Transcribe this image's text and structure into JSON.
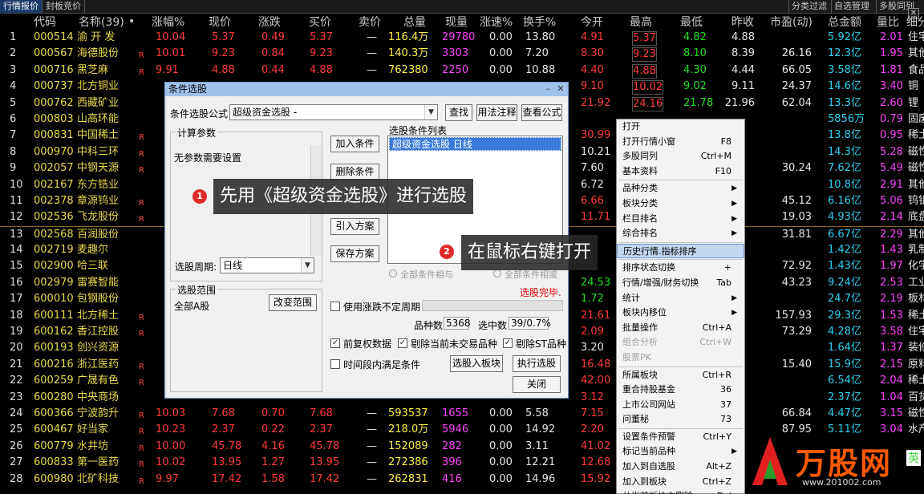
{
  "tabs": [
    {
      "label": "行情报价",
      "active": true
    },
    {
      "label": "封板竞价",
      "active": false
    }
  ],
  "top_right_tabs": [
    "分类过滤",
    "自选管理",
    "多股同列"
  ],
  "columns": [
    "代码",
    "名称(39)",
    "•",
    "涨幅%",
    "现价",
    "涨跌",
    "买价",
    "卖价",
    "总量",
    "现量",
    "涨速%",
    "换手%",
    "今开",
    "最高",
    "最低",
    "昨收",
    "市盈(动)",
    "总金额",
    "量比",
    "细分"
  ],
  "rows": [
    {
      "no": "1",
      "code": "000514",
      "name": "渝 开 发",
      "r": "",
      "pct": "10.04",
      "price": "5.37",
      "chg": "0.49",
      "bid": "5.37",
      "ask": "—",
      "vol": "116.4万",
      "cur": "29780",
      "spd": "0.00",
      "turn": "13.80",
      "open": "4.91",
      "high": "5.37",
      "low": "4.82",
      "prev": "4.88",
      "pe": "",
      "amt": "5.92亿",
      "qr": "2.01",
      "ind": "住宅"
    },
    {
      "no": "2",
      "code": "000567",
      "name": "海德股份",
      "r": "R",
      "pct": "10.01",
      "price": "9.23",
      "chg": "0.84",
      "bid": "9.23",
      "ask": "—",
      "vol": "140.3万",
      "cur": "3303",
      "spd": "0.00",
      "turn": "7.20",
      "open": "8.30",
      "high": "9.23",
      "low": "8.10",
      "prev": "8.39",
      "pe": "26.16",
      "amt": "12.3亿",
      "qr": "1.95",
      "ind": "其他"
    },
    {
      "no": "3",
      "code": "000716",
      "name": "黑芝麻",
      "r": "R",
      "pct": "9.91",
      "price": "4.88",
      "chg": "0.44",
      "bid": "4.88",
      "ask": "—",
      "vol": "762380",
      "cur": "2250",
      "spd": "0.00",
      "turn": "10.88",
      "open": "4.40",
      "high": "4.88",
      "low": "4.30",
      "prev": "4.44",
      "pe": "66.05",
      "amt": "3.58亿",
      "qr": "1.81",
      "ind": "食品"
    },
    {
      "no": "4",
      "code": "000737",
      "name": "北方铜业",
      "r": "",
      "pct": "",
      "price": "",
      "chg": "",
      "bid": "",
      "ask": "",
      "vol": "",
      "cur": "",
      "spd": "",
      "turn": "",
      "open": "9.10",
      "high": "10.02",
      "low": "9.02",
      "prev": "9.11",
      "pe": "24.37",
      "amt": "14.6亿",
      "qr": "3.40",
      "ind": "铜"
    },
    {
      "no": "5",
      "code": "000762",
      "name": "西藏矿业",
      "r": "",
      "pct": "",
      "price": "",
      "chg": "",
      "bid": "",
      "ask": "",
      "vol": "",
      "cur": "",
      "spd": "",
      "turn": "",
      "open": "21.92",
      "high": "24.16",
      "low": "21.78",
      "prev": "21.96",
      "pe": "62.04",
      "amt": "13.3亿",
      "qr": "2.60",
      "ind": "锂"
    },
    {
      "no": "6",
      "code": "000803",
      "name": "山高环能",
      "r": "",
      "pct": "",
      "price": "",
      "chg": "",
      "bid": "",
      "ask": "",
      "vol": "",
      "cur": "",
      "spd": "",
      "turn": "",
      "open": "",
      "high": "",
      "low": "",
      "prev": "",
      "pe": "",
      "amt": "5856万",
      "qr": "0.79",
      "ind": "固废"
    },
    {
      "no": "7",
      "code": "000831",
      "name": "中国稀土",
      "r": "R",
      "pct": "",
      "price": "",
      "chg": "",
      "bid": "",
      "ask": "",
      "vol": "",
      "cur": "",
      "spd": "",
      "turn": "",
      "open": "30.99",
      "high": "",
      "low": "",
      "prev": "",
      "pe": "",
      "amt": "13.8亿",
      "qr": "0.95",
      "ind": "稀土"
    },
    {
      "no": "8",
      "code": "000970",
      "name": "中科三环",
      "r": "R",
      "pct": "",
      "price": "",
      "chg": "",
      "bid": "",
      "ask": "",
      "vol": "",
      "cur": "",
      "spd": "",
      "turn": "",
      "open": "10.21",
      "high": "",
      "low": "",
      "prev": "",
      "pe": "",
      "amt": "14.3亿",
      "qr": "5.28",
      "ind": "磁性"
    },
    {
      "no": "9",
      "code": "002057",
      "name": "中钢天源",
      "r": "R",
      "pct": "",
      "price": "",
      "chg": "",
      "bid": "",
      "ask": "",
      "vol": "",
      "cur": "",
      "spd": "",
      "turn": "",
      "open": "7.60",
      "high": "",
      "low": "",
      "prev": "",
      "pe": "30.24",
      "amt": "7.62亿",
      "qr": "5.49",
      "ind": "磁性"
    },
    {
      "no": "10",
      "code": "002167",
      "name": "东方锆业",
      "r": "",
      "pct": "",
      "price": "",
      "chg": "",
      "bid": "",
      "ask": "",
      "vol": "",
      "cur": "",
      "spd": "",
      "turn": "",
      "open": "6.72",
      "high": "",
      "low": "",
      "prev": "",
      "pe": "",
      "amt": "10.8亿",
      "qr": "2.91",
      "ind": "其他"
    },
    {
      "no": "11",
      "code": "002378",
      "name": "章源钨业",
      "r": "R",
      "pct": "",
      "price": "",
      "chg": "",
      "bid": "",
      "ask": "",
      "vol": "",
      "cur": "",
      "spd": "",
      "turn": "",
      "open": "6.66",
      "high": "",
      "low": "",
      "prev": "",
      "pe": "45.12",
      "amt": "6.16亿",
      "qr": "5.06",
      "ind": "钨钼"
    },
    {
      "no": "12",
      "code": "002536",
      "name": "飞龙股份",
      "r": "R",
      "pct": "",
      "price": "",
      "chg": "",
      "bid": "",
      "ask": "",
      "vol": "",
      "cur": "",
      "spd": "",
      "turn": "",
      "open": "11.71",
      "high": "",
      "low": "",
      "prev": "",
      "pe": "19.03",
      "amt": "4.93亿",
      "qr": "2.14",
      "ind": "底盘"
    },
    {
      "no": "13",
      "code": "002568",
      "name": "百润股份",
      "r": "",
      "pct": "",
      "price": "",
      "chg": "",
      "bid": "",
      "ask": "",
      "vol": "",
      "cur": "",
      "spd": "",
      "turn": "",
      "open": "",
      "high": "",
      "low": "",
      "prev": "",
      "pe": "31.81",
      "amt": "6.67亿",
      "qr": "2.29",
      "ind": "其他"
    },
    {
      "no": "14",
      "code": "002719",
      "name": "麦趣尔",
      "r": "",
      "pct": "",
      "price": "",
      "chg": "",
      "bid": "",
      "ask": "",
      "vol": "",
      "cur": "",
      "spd": "",
      "turn": "",
      "open": "",
      "high": "",
      "low": "",
      "prev": "",
      "pe": "",
      "amt": "1.42亿",
      "qr": "1.43",
      "ind": "乳制"
    },
    {
      "no": "15",
      "code": "002900",
      "name": "哈三联",
      "r": "",
      "pct": "",
      "price": "",
      "chg": "",
      "bid": "",
      "ask": "",
      "vol": "",
      "cur": "",
      "spd": "",
      "turn": "",
      "open": "",
      "high": "",
      "low": "",
      "prev": "",
      "pe": "72.92",
      "amt": "1.43亿",
      "qr": "1.97",
      "ind": "化学"
    },
    {
      "no": "16",
      "code": "002979",
      "name": "雷赛智能",
      "r": "",
      "pct": "",
      "price": "",
      "chg": "",
      "bid": "",
      "ask": "",
      "vol": "",
      "cur": "",
      "spd": "",
      "turn": "",
      "open": "24.53",
      "high": "",
      "low": "",
      "prev": "",
      "pe": "43.23",
      "amt": "9.24亿",
      "qr": "2.53",
      "ind": "工业"
    },
    {
      "no": "17",
      "code": "600010",
      "name": "包钢股份",
      "r": "",
      "pct": "",
      "price": "",
      "chg": "",
      "bid": "",
      "ask": "",
      "vol": "",
      "cur": "",
      "spd": "",
      "turn": "",
      "open": "1.72",
      "high": "",
      "low": "",
      "prev": "",
      "pe": "",
      "amt": "24.7亿",
      "qr": "2.19",
      "ind": "板材"
    },
    {
      "no": "18",
      "code": "600111",
      "name": "北方稀土",
      "r": "R",
      "pct": "",
      "price": "",
      "chg": "",
      "bid": "",
      "ask": "",
      "vol": "",
      "cur": "",
      "spd": "",
      "turn": "",
      "open": "21.61",
      "high": "",
      "low": "",
      "prev": "",
      "pe": "157.93",
      "amt": "29.3亿",
      "qr": "1.53",
      "ind": "稀土"
    },
    {
      "no": "19",
      "code": "600162",
      "name": "香江控股",
      "r": "R",
      "pct": "",
      "price": "",
      "chg": "",
      "bid": "",
      "ask": "",
      "vol": "",
      "cur": "",
      "spd": "",
      "turn": "",
      "open": "2.09",
      "high": "",
      "low": "",
      "prev": "",
      "pe": "73.29",
      "amt": "4.28亿",
      "qr": "3.58",
      "ind": "住宅"
    },
    {
      "no": "20",
      "code": "600193",
      "name": "创兴资源",
      "r": "",
      "pct": "",
      "price": "",
      "chg": "",
      "bid": "",
      "ask": "",
      "vol": "",
      "cur": "",
      "spd": "",
      "turn": "",
      "open": "3.20",
      "high": "",
      "low": "",
      "prev": "",
      "pe": "",
      "amt": "1.64亿",
      "qr": "1.37",
      "ind": "装修"
    },
    {
      "no": "21",
      "code": "600216",
      "name": "浙江医药",
      "r": "R",
      "pct": "",
      "price": "",
      "chg": "",
      "bid": "",
      "ask": "",
      "vol": "",
      "cur": "",
      "spd": "",
      "turn": "",
      "open": "16.48",
      "high": "",
      "low": "",
      "prev": "",
      "pe": "15.40",
      "amt": "15.9亿",
      "qr": "2.15",
      "ind": "原料"
    },
    {
      "no": "22",
      "code": "600259",
      "name": "广晟有色",
      "r": "R",
      "pct": "",
      "price": "",
      "chg": "",
      "bid": "",
      "ask": "",
      "vol": "",
      "cur": "",
      "spd": "",
      "turn": "",
      "open": "42.00",
      "high": "",
      "low": "",
      "prev": "",
      "pe": "",
      "amt": "6.54亿",
      "qr": "2.04",
      "ind": "稀土"
    },
    {
      "no": "23",
      "code": "600280",
      "name": "中央商场",
      "r": "",
      "pct": "",
      "price": "",
      "chg": "",
      "bid": "",
      "ask": "",
      "vol": "",
      "cur": "",
      "spd": "",
      "turn": "",
      "open": "3.12",
      "high": "",
      "low": "",
      "prev": "",
      "pe": "",
      "amt": "2.37亿",
      "qr": "1.04",
      "ind": "百货"
    },
    {
      "no": "24",
      "code": "600366",
      "name": "宁波韵升",
      "r": "R",
      "pct": "10.03",
      "price": "7.68",
      "chg": "0.70",
      "bid": "7.68",
      "ask": "—",
      "vol": "593537",
      "cur": "1655",
      "spd": "0.00",
      "turn": "5.58",
      "open": "7.15",
      "high": "",
      "low": "",
      "prev": "",
      "pe": "66.84",
      "amt": "4.47亿",
      "qr": "3.15",
      "ind": "磁性"
    },
    {
      "no": "25",
      "code": "600467",
      "name": "好当家",
      "r": "R",
      "pct": "10.23",
      "price": "2.37",
      "chg": "0.22",
      "bid": "2.37",
      "ask": "—",
      "vol": "218.0万",
      "cur": "5946",
      "spd": "0.00",
      "turn": "14.92",
      "open": "2.20",
      "high": "",
      "low": "",
      "prev": "",
      "pe": "87.95",
      "amt": "5.11亿",
      "qr": "3.04",
      "ind": "水产"
    },
    {
      "no": "26",
      "code": "600779",
      "name": "水井坊",
      "r": "R",
      "pct": "10.00",
      "price": "45.78",
      "chg": "4.16",
      "bid": "45.78",
      "ask": "—",
      "vol": "152089",
      "cur": "282",
      "spd": "0.00",
      "turn": "3.11",
      "open": "41.02",
      "high": "",
      "low": "",
      "prev": "",
      "pe": "",
      "amt": "",
      "qr": "",
      "ind": ""
    },
    {
      "no": "27",
      "code": "600833",
      "name": "第一医药",
      "r": "R",
      "pct": "10.02",
      "price": "13.95",
      "chg": "1.27",
      "bid": "13.95",
      "ask": "—",
      "vol": "272386",
      "cur": "396",
      "spd": "0.00",
      "turn": "12.21",
      "open": "12.68",
      "high": "",
      "low": "",
      "prev": "",
      "pe": "",
      "amt": "",
      "qr": "",
      "ind": ""
    },
    {
      "no": "28",
      "code": "600980",
      "name": "北矿科技",
      "r": "R",
      "pct": "9.97",
      "price": "17.42",
      "chg": "1.58",
      "bid": "17.42",
      "ask": "—",
      "vol": "262831",
      "cur": "416",
      "spd": "0.00",
      "turn": "14.96",
      "open": "15.92",
      "high": "",
      "low": "",
      "prev": "",
      "pe": "",
      "amt": "",
      "qr": "",
      "ind": ""
    }
  ],
  "dialog": {
    "title": "条件选股",
    "formula_label": "条件选股公式",
    "formula_value": "超级资金选股 -",
    "btn_find": "查找",
    "btn_usage": "用法注释",
    "btn_view_formula": "查看公式",
    "calc_params_title": "计算参数",
    "no_params": "无参数需要设置",
    "btn_add": "加入条件",
    "btn_delete": "删除条件",
    "btn_import": "引入方案",
    "btn_save": "保存方案",
    "cond_list_title": "选股条件列表",
    "cond_item": "超级资金选股  日线",
    "period_label": "选股周期:",
    "period_value": "日线",
    "radio_and": "全部条件相与",
    "radio_or": "全部条件相或",
    "done": "选股完毕.",
    "range_title": "选股范围",
    "range_value": "全部A股",
    "btn_change_range": "改变范围",
    "chk_uncertain": "使用涨跌不定周期",
    "total_label": "品种数",
    "total_value": "5368",
    "selected_label": "选中数",
    "selected_value": "39/0.7%",
    "chk_fq": "前复权数据",
    "chk_exclude_untraded": "剔除当前未交易品种",
    "chk_exclude_st": "剔除ST品种",
    "chk_period_meet": "时间段内满足条件",
    "btn_to_block": "选股入板块",
    "btn_execute": "执行选股",
    "btn_close": "关闭"
  },
  "annotations": [
    {
      "num": "1",
      "text": "先用《超级资金选股》进行选股"
    },
    {
      "num": "2",
      "text": "在鼠标右键打开"
    }
  ],
  "menu": [
    {
      "label": "打开",
      "key": "",
      "sub": false,
      "hl": false,
      "dis": false,
      "sep_after": false
    },
    {
      "label": "打开行情小窗",
      "key": "F8",
      "sub": false,
      "hl": false,
      "dis": false,
      "sep_after": false
    },
    {
      "label": "多股同列",
      "key": "Ctrl+M",
      "sub": false,
      "hl": false,
      "dis": false,
      "sep_after": false
    },
    {
      "label": "基本资料",
      "key": "F10",
      "sub": false,
      "hl": false,
      "dis": false,
      "sep_after": true
    },
    {
      "label": "品种分类",
      "key": "",
      "sub": true,
      "hl": false,
      "dis": false,
      "sep_after": false
    },
    {
      "label": "板块分类",
      "key": "",
      "sub": true,
      "hl": false,
      "dis": false,
      "sep_after": false
    },
    {
      "label": "栏目排名",
      "key": "",
      "sub": true,
      "hl": false,
      "dis": false,
      "sep_after": false
    },
    {
      "label": "综合排名",
      "key": "",
      "sub": true,
      "hl": false,
      "dis": false,
      "sep_after": true
    },
    {
      "label": "历史行情.指标排序",
      "key": "",
      "sub": false,
      "hl": true,
      "dis": false,
      "sep_after": true
    },
    {
      "label": "排序状态切换",
      "key": "+",
      "sub": false,
      "hl": false,
      "dis": false,
      "sep_after": false
    },
    {
      "label": "行情/增强/财务切换",
      "key": "Tab",
      "sub": false,
      "hl": false,
      "dis": false,
      "sep_after": false
    },
    {
      "label": "统计",
      "key": "",
      "sub": true,
      "hl": false,
      "dis": false,
      "sep_after": false
    },
    {
      "label": "板块内移位",
      "key": "",
      "sub": true,
      "hl": false,
      "dis": false,
      "sep_after": false
    },
    {
      "label": "批量操作",
      "key": "Ctrl+A",
      "sub": false,
      "hl": false,
      "dis": false,
      "sep_after": false
    },
    {
      "label": "组合分析",
      "key": "Ctrl+W",
      "sub": false,
      "hl": false,
      "dis": true,
      "sep_after": false
    },
    {
      "label": "股票PK",
      "key": "",
      "sub": false,
      "hl": false,
      "dis": true,
      "sep_after": true
    },
    {
      "label": "所属板块",
      "key": "Ctrl+R",
      "sub": false,
      "hl": false,
      "dis": false,
      "sep_after": false
    },
    {
      "label": "重合持股基金",
      "key": "36",
      "sub": false,
      "hl": false,
      "dis": false,
      "sep_after": false
    },
    {
      "label": "上市公司网站",
      "key": "37",
      "sub": false,
      "hl": false,
      "dis": false,
      "sep_after": false
    },
    {
      "label": "问董秘",
      "key": "73",
      "sub": false,
      "hl": false,
      "dis": false,
      "sep_after": true
    },
    {
      "label": "设置条件预警",
      "key": "Ctrl+Y",
      "sub": false,
      "hl": false,
      "dis": false,
      "sep_after": false
    },
    {
      "label": "标记当前品种",
      "key": "",
      "sub": true,
      "hl": false,
      "dis": false,
      "sep_after": false
    },
    {
      "label": "加入到自选股",
      "key": "Alt+Z",
      "sub": false,
      "hl": false,
      "dis": false,
      "sep_after": false
    },
    {
      "label": "加入到板块",
      "key": "Ctrl+Z",
      "sub": false,
      "hl": false,
      "dis": false,
      "sep_after": false
    },
    {
      "label": "从当前板块中删除",
      "key": "Del",
      "sub": false,
      "hl": false,
      "dis": false,
      "sep_after": false
    }
  ],
  "logo": {
    "brand": "万股网",
    "url": "www.201002.com",
    "tag": "英"
  },
  "colors": {
    "up": "#ff3b3b",
    "down": "#22dd22",
    "code": "#e9d94c",
    "accent": "#3b7ad8"
  }
}
